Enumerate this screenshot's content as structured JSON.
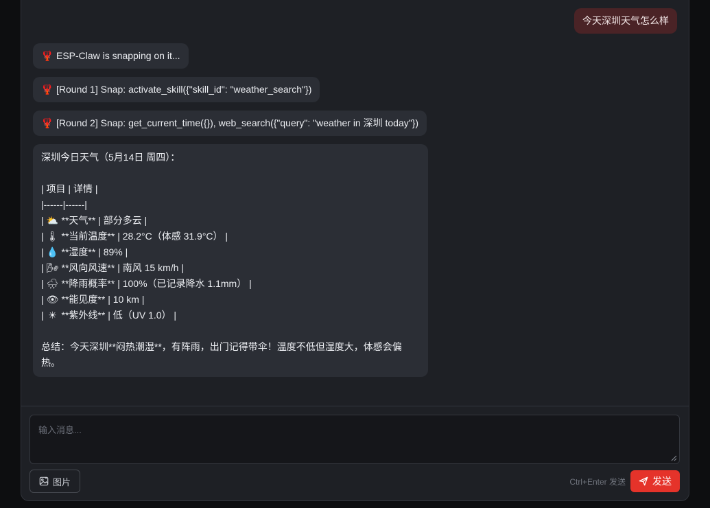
{
  "chat": {
    "user_message": "今天深圳天气怎么样",
    "status_messages": [
      {
        "icon": "lobster-icon",
        "glyph": "🦞",
        "text": "ESP-Claw is snapping on it..."
      },
      {
        "icon": "lobster-icon",
        "glyph": "🦞",
        "text": "[Round 1] Snap: activate_skill({\"skill_id\": \"weather_search\"})"
      },
      {
        "icon": "lobster-icon",
        "glyph": "🦞",
        "text": "[Round 2] Snap: get_current_time({}), web_search({\"query\": \"weather in 深圳 today\"})"
      }
    ],
    "reply": {
      "heading": "深圳今日天气（5月14日 周四）：",
      "table_header": "| 项目 | 详情 |",
      "table_divider": "|------|------|",
      "rows": [
        {
          "icon": "sun-cloud-icon",
          "glyph": "⛅",
          "text": "**天气** | 部分多云 |"
        },
        {
          "icon": "thermometer-icon",
          "glyph": "🌡",
          "text": "**当前温度** | 28.2°C（体感 31.9°C） |"
        },
        {
          "icon": "droplet-icon",
          "glyph": "💧",
          "text": "**湿度** | 89% |"
        },
        {
          "icon": "wind-icon",
          "glyph": "🌬",
          "text": "**风向风速** | 南风 15 km/h |"
        },
        {
          "icon": "rain-cloud-icon",
          "glyph": "🌧",
          "text": "**降雨概率** | 100%（已记录降水 1.1mm） |"
        },
        {
          "icon": "eye-icon",
          "glyph": "👁",
          "text": "**能见度** | 10 km |"
        },
        {
          "icon": "sun-icon",
          "glyph": "☀",
          "text": "**紫外线** | 低（UV 1.0） |"
        }
      ],
      "summary": "总结：今天深圳**闷热潮湿**，有阵雨，出门记得带伞！温度不低但湿度大，体感会偏热。"
    }
  },
  "composer": {
    "placeholder": "输入消息...",
    "image_button_label": "图片",
    "hint": "Ctrl+Enter 发送",
    "send_label": "发送"
  },
  "colors": {
    "accent": "#e5332a",
    "user_bubble": "#4a2326",
    "bot_bubble": "#2b2e35",
    "panel": "#1e2025"
  }
}
